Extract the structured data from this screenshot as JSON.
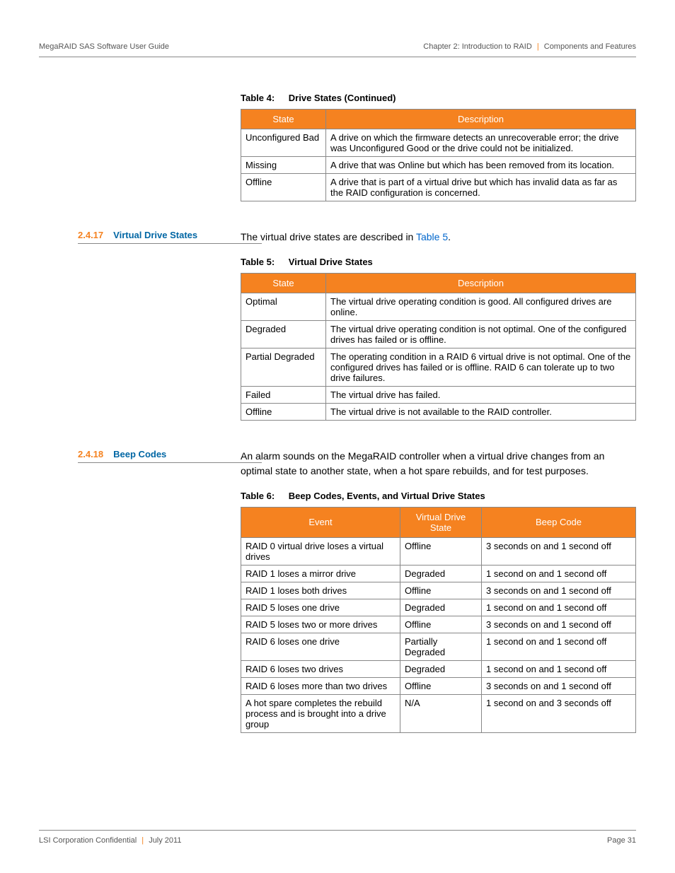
{
  "header": {
    "left": "MegaRAID SAS Software User Guide",
    "right_chapter": "Chapter 2: Introduction to RAID",
    "right_section": "Components and Features"
  },
  "table4": {
    "caption_num": "Table 4:",
    "caption_title": "Drive States (Continued)",
    "headers": [
      "State",
      "Description"
    ],
    "rows": [
      [
        "Unconfigured Bad",
        "A drive on which the firmware detects an unrecoverable error; the drive was Unconfigured Good or the drive could not be initialized."
      ],
      [
        "Missing",
        "A drive that was Online but which has been removed from its location."
      ],
      [
        "Offline",
        "A drive that is part of a virtual drive but which has invalid data as far as the RAID configuration is concerned."
      ]
    ]
  },
  "sec17": {
    "num": "2.4.17",
    "title": "Virtual Drive States",
    "intro_pre": "The virtual drive states are described in ",
    "intro_link": "Table 5",
    "intro_post": "."
  },
  "table5": {
    "caption_num": "Table 5:",
    "caption_title": "Virtual Drive States",
    "headers": [
      "State",
      "Description"
    ],
    "rows": [
      [
        "Optimal",
        "The virtual drive operating condition is good. All configured drives are online."
      ],
      [
        "Degraded",
        "The virtual drive operating condition is not optimal. One of the configured drives has failed or is offline."
      ],
      [
        "Partial Degraded",
        "The operating condition in a RAID 6 virtual drive is not optimal. One of the configured drives has failed or is offline. RAID 6 can tolerate up to two drive failures."
      ],
      [
        "Failed",
        "The virtual drive has failed."
      ],
      [
        "Offline",
        "The virtual drive is not available to the RAID controller."
      ]
    ]
  },
  "sec18": {
    "num": "2.4.18",
    "title": "Beep Codes",
    "intro": "An alarm sounds on the MegaRAID controller when a virtual drive changes from an optimal state to another state, when a hot spare rebuilds, and for test purposes."
  },
  "table6": {
    "caption_num": "Table 6:",
    "caption_title": "Beep Codes, Events, and Virtual Drive States",
    "headers": [
      "Event",
      "Virtual Drive State",
      "Beep Code"
    ],
    "rows": [
      [
        "RAID 0 virtual drive loses a virtual drives",
        "Offline",
        "3 seconds on and 1 second off"
      ],
      [
        "RAID 1 loses a mirror drive",
        "Degraded",
        "1 second on and 1 second off"
      ],
      [
        "RAID 1 loses both drives",
        "Offline",
        "3 seconds on and 1 second off"
      ],
      [
        "RAID 5 loses one drive",
        "Degraded",
        "1 second on and 1 second off"
      ],
      [
        "RAID 5 loses two or more drives",
        "Offline",
        "3 seconds on and 1 second off"
      ],
      [
        "RAID 6 loses one drive",
        "Partially Degraded",
        "1 second on and 1 second off"
      ],
      [
        "RAID 6 loses two drives",
        "Degraded",
        "1 second on and 1 second off"
      ],
      [
        "RAID 6 loses more than two drives",
        "Offline",
        "3 seconds on and 1 second off"
      ],
      [
        "A hot spare completes the rebuild process and is brought into a drive group",
        "N/A",
        "1 second on and 3 seconds off"
      ]
    ]
  },
  "footer": {
    "left_a": "LSI Corporation Confidential",
    "left_b": "July 2011",
    "right": "Page 31"
  }
}
